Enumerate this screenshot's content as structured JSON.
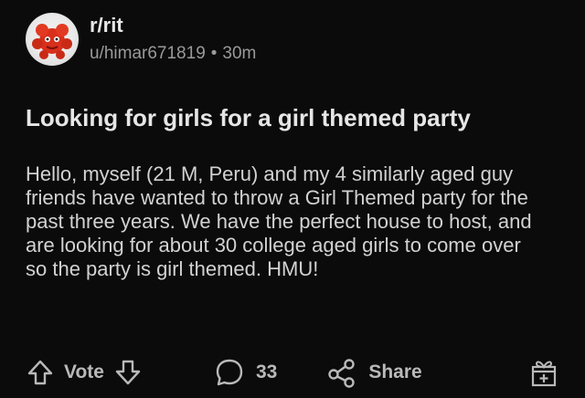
{
  "post": {
    "subreddit": "r/rit",
    "author": "u/himar671819",
    "separator": "•",
    "age": "30m",
    "title": "Looking for girls for a girl themed party",
    "body": "Hello, myself (21 M, Peru) and my 4 similarly aged guy friends have wanted to throw a Girl Themed party for the past three years. We have the perfect house to host, and are looking for about 30 college aged girls to come over so the party is girl themed. HMU!"
  },
  "actions": {
    "vote_label": "Vote",
    "comment_count": "33",
    "share_label": "Share"
  },
  "icons": {
    "avatar": "subreddit-avatar",
    "upvote": "arrow-up-icon",
    "downvote": "arrow-down-icon",
    "comment": "comment-bubble-icon",
    "share": "share-icon",
    "award": "gift-award-icon"
  },
  "colors": {
    "background": "#0b0b0b",
    "text_primary": "#e6e6e6",
    "text_secondary": "#9a9a9a",
    "icon": "#b9b9b9",
    "avatar_accent": "#d8301c"
  }
}
